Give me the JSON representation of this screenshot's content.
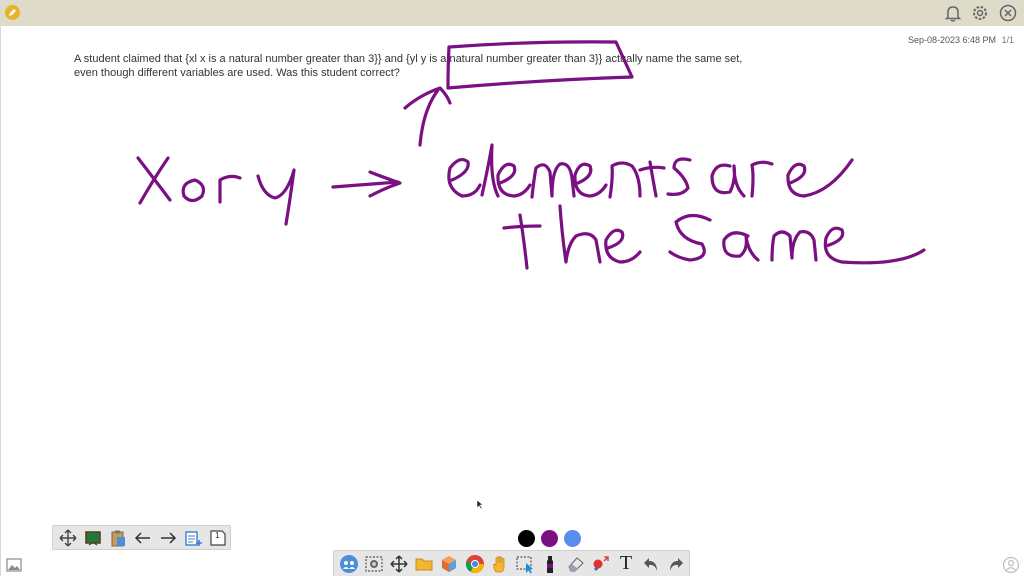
{
  "header": {
    "logo_icon": "pencil-icon",
    "icons": [
      "bell-icon",
      "gear-icon",
      "close-circle-icon"
    ],
    "bg_color": "#dedbc9"
  },
  "page": {
    "datetime": "Sep-08-2023 6:48 PM",
    "page_number": "1/1"
  },
  "question": {
    "line1": "A student claimed that {xl x is a natural number greater than 3}} and {yl y is a natural number greater than 3}} actually name the same set,",
    "line2": "even though different variables are used. Was this student correct?"
  },
  "handwriting": {
    "line1": "x or y → elements are",
    "line2": "the same",
    "ink_color": "#7a1082"
  },
  "left_toolbar": {
    "tools": [
      "move-arrows-icon",
      "green-board-icon",
      "clipboard-icon",
      "arrow-left-icon",
      "arrow-right-icon",
      "add-page-icon",
      "page-1-icon"
    ],
    "page_label": "1"
  },
  "pen_colors": [
    "#000000",
    "#7a1082",
    "#5b8def"
  ],
  "bottom_toolbar": {
    "tools": [
      "participants-icon",
      "screenshot-icon",
      "move-icon",
      "folder-icon",
      "shapes-icon",
      "chrome-icon",
      "hand-icon",
      "select-icon",
      "marker-icon",
      "eraser-icon",
      "laser-icon",
      "text-icon",
      "undo-icon",
      "redo-icon"
    ],
    "text_tool_label": "T"
  }
}
